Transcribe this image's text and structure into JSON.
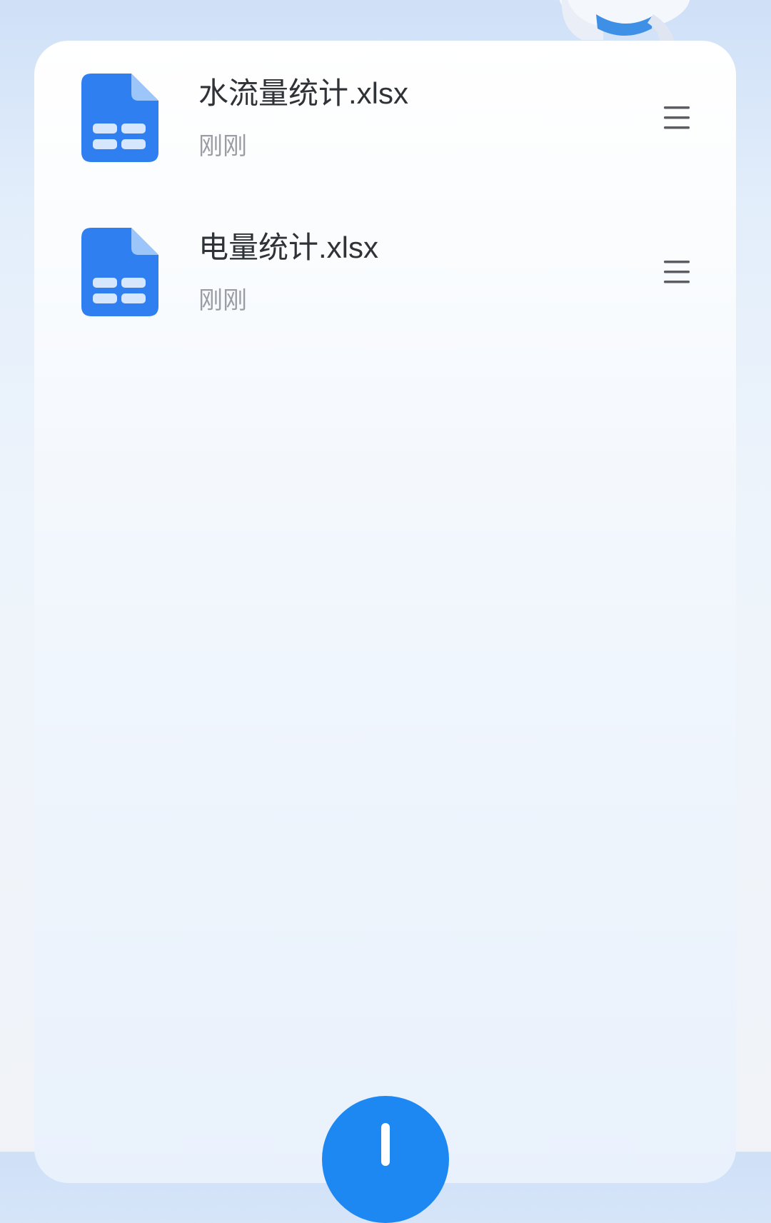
{
  "files": [
    {
      "name": "水流量统计.xlsx",
      "time": "刚刚",
      "icon": "spreadsheet-file-icon"
    },
    {
      "name": "电量统计.xlsx",
      "time": "刚刚",
      "icon": "spreadsheet-file-icon"
    }
  ],
  "icons": {
    "menu": "menu-icon",
    "add": "plus-icon"
  },
  "colors": {
    "accent": "#1e88f2",
    "file_icon": "#2f7ff0",
    "file_name": "#2f3237",
    "file_time": "#9a9da3"
  }
}
